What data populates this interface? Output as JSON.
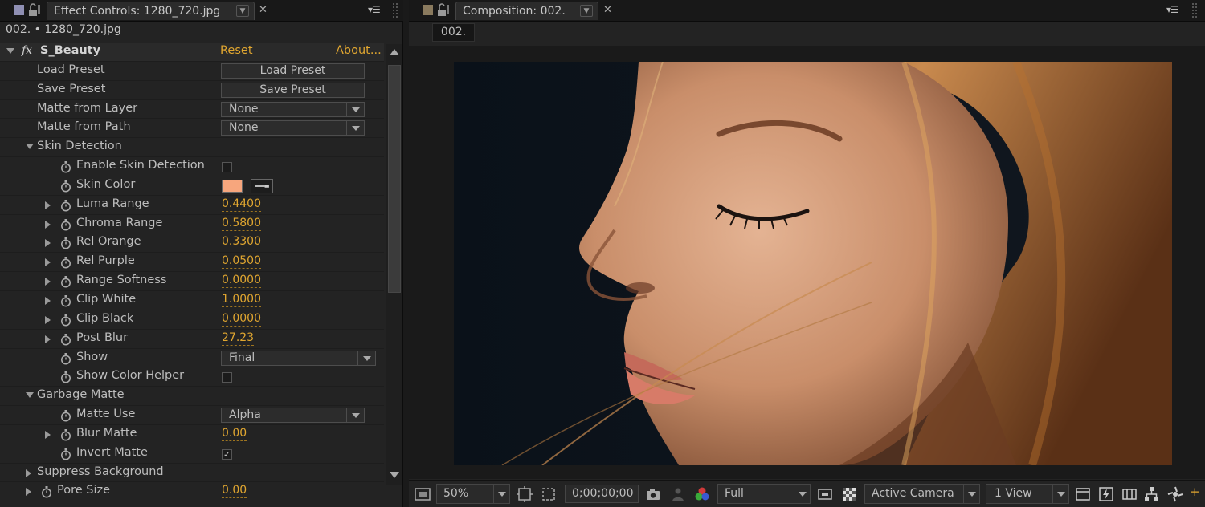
{
  "effect_panel": {
    "tab_title": "Effect Controls: 1280_720.jpg",
    "layer_label": "002. • 1280_720.jpg",
    "effect": {
      "name": "S_Beauty",
      "reset_label": "Reset",
      "about_label": "About..."
    },
    "rows": {
      "load_preset": {
        "label": "Load Preset",
        "button": "Load Preset"
      },
      "save_preset": {
        "label": "Save Preset",
        "button": "Save Preset"
      },
      "matte_from_layer": {
        "label": "Matte from Layer",
        "value": "None"
      },
      "matte_from_path": {
        "label": "Matte from Path",
        "value": "None"
      },
      "skin_detection": {
        "label": "Skin Detection"
      },
      "enable_skin_detection": {
        "label": "Enable Skin Detection",
        "checked": false
      },
      "skin_color": {
        "label": "Skin Color",
        "color": "#f7a67d"
      },
      "luma_range": {
        "label": "Luma Range",
        "value": "0.4400"
      },
      "chroma_range": {
        "label": "Chroma Range",
        "value": "0.5800"
      },
      "rel_orange": {
        "label": "Rel Orange",
        "value": "0.3300"
      },
      "rel_purple": {
        "label": "Rel Purple",
        "value": "0.0500"
      },
      "range_softness": {
        "label": "Range Softness",
        "value": "0.0000"
      },
      "clip_white": {
        "label": "Clip White",
        "value": "1.0000"
      },
      "clip_black": {
        "label": "Clip Black",
        "value": "0.0000"
      },
      "post_blur": {
        "label": "Post Blur",
        "value": "27.23"
      },
      "show": {
        "label": "Show",
        "value": "Final"
      },
      "show_color_helper": {
        "label": "Show Color Helper",
        "checked": false
      },
      "garbage_matte": {
        "label": "Garbage Matte"
      },
      "matte_use": {
        "label": "Matte Use",
        "value": "Alpha"
      },
      "blur_matte": {
        "label": "Blur Matte",
        "value": "0.00"
      },
      "invert_matte": {
        "label": "Invert Matte",
        "checked": true,
        "mark": "✓"
      },
      "suppress_background": {
        "label": "Suppress Background"
      },
      "pore_size": {
        "label": "Pore Size",
        "value": "0.00"
      }
    }
  },
  "composition_panel": {
    "tab_title": "Composition: 002.",
    "subtab": "002.",
    "toolbar": {
      "zoom": "50%",
      "timecode": "0;00;00;00",
      "resolution": "Full",
      "camera": "Active Camera",
      "views": "1 View",
      "plus": "+"
    }
  },
  "colors": {
    "accent_orange": "#e0a630",
    "panel_bg": "#232323",
    "skin_swatch": "#f7a67d"
  },
  "icons": [
    "lock-icon",
    "panel-menu-icon",
    "close-icon",
    "stopwatch-icon",
    "camera-icon",
    "color-channels-icon",
    "region-of-interest-icon",
    "transparency-grid-icon",
    "fast-preview-icon",
    "flowchart-icon"
  ]
}
